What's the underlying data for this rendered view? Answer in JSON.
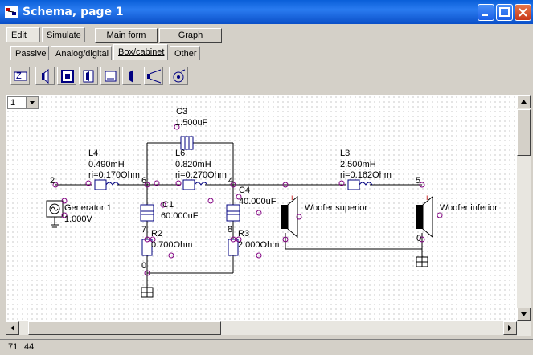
{
  "window": {
    "title": "Schema, page 1"
  },
  "menu_tabs": [
    {
      "label": "Edit"
    },
    {
      "label": "Simulate"
    }
  ],
  "buttons": {
    "main_form": "Main form",
    "graph": "Graph"
  },
  "category_tabs": [
    {
      "label": "Passive"
    },
    {
      "label": "Analog/digital"
    },
    {
      "label": "Box/cabinet"
    },
    {
      "label": "Other"
    }
  ],
  "toolbar_icons": [
    "box-icon",
    "speaker-icon",
    "cabinet-icon",
    "port-speaker-icon",
    "panel-icon",
    "driver-icon",
    "horn-icon",
    "radiator-icon"
  ],
  "page_select": {
    "value": "1"
  },
  "schematic": {
    "components": {
      "c3": {
        "name": "C3",
        "value": "1.500uF"
      },
      "l4": {
        "name": "L4",
        "value": "0.490mH",
        "ri": "ri=0.170Ohm"
      },
      "l6": {
        "name": "L6",
        "value": "0.820mH",
        "ri": "ri=0.270Ohm"
      },
      "l3": {
        "name": "L3",
        "value": "2.500mH",
        "ri": "ri=0.162Ohm"
      },
      "c1": {
        "name": "C1",
        "value": "60.000uF"
      },
      "c4": {
        "name": "C4",
        "value": "40.000uF"
      },
      "r2": {
        "name": "R2",
        "value": "0.700Ohm"
      },
      "r3": {
        "name": "R3",
        "value": "2.000Ohm"
      },
      "generator": {
        "name": "Generator 1",
        "value": "1.000V"
      },
      "woofer_superior": {
        "name": "Woofer superior"
      },
      "woofer_inferior": {
        "name": "Woofer inferior"
      }
    },
    "nodes": {
      "n2": "2",
      "n6": "6",
      "n4": "4",
      "n5": "5",
      "n7": "7",
      "n8": "8",
      "n0a": "0",
      "n0b": "0"
    },
    "colors": {
      "wire": "#000000",
      "pin": "#800080",
      "component": "#000080"
    }
  },
  "status": {
    "x": "71",
    "y": "44"
  }
}
